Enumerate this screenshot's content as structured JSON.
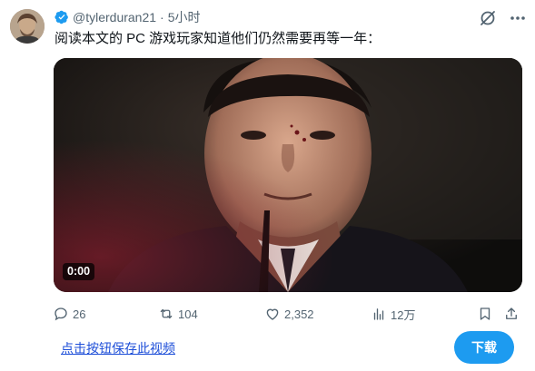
{
  "tweet": {
    "handle": "@tylerduran21",
    "separator": "·",
    "time": "5小时",
    "text": "阅读本文的 PC 游戏玩家知道他们仍然需要再等一年："
  },
  "media": {
    "duration": "0:00"
  },
  "actions": {
    "replies": "26",
    "retweets": "104",
    "likes": "2,352",
    "views": "12万"
  },
  "footer": {
    "save_link": "点击按钮保存此视频",
    "download_label": "下载"
  },
  "colors": {
    "accent": "#1d9bf0",
    "muted": "#536471",
    "text": "#0f1419",
    "link": "#1d4ed8"
  },
  "icons": [
    "verified-badge-icon",
    "grok-icon",
    "more-icon",
    "reply-icon",
    "retweet-icon",
    "like-icon",
    "views-icon",
    "bookmark-icon",
    "share-icon"
  ]
}
